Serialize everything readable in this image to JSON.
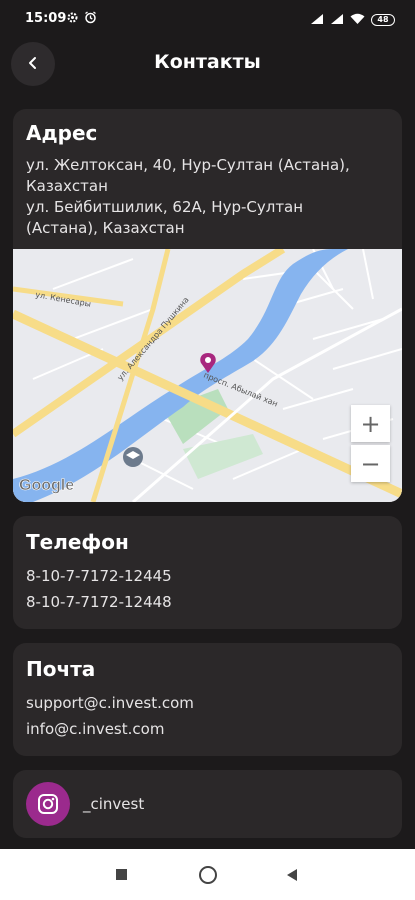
{
  "status_bar": {
    "time": "15:09",
    "battery": "48"
  },
  "header": {
    "title": "Контакты"
  },
  "address": {
    "title": "Адрес",
    "lines": [
      "ул. Желтоксан, 40, Нур-Султан (Астана),",
      "Казахстан",
      "ул. Бейбитшилик, 62А, Нур-Султан",
      "(Астана), Казахстан"
    ]
  },
  "map": {
    "street_labels": [
      "ул. Кенесары",
      "ул. Александра Пушкина",
      "просп. Абылай хан"
    ],
    "provider": "Google",
    "zoom_in": "+",
    "zoom_out": "−",
    "colors": {
      "water": "#86b4ef",
      "road": "#f7dc88",
      "park": "#b9dfbd",
      "marker": "#a8277e"
    }
  },
  "phone": {
    "title": "Телефон",
    "numbers": [
      "8-10-7-7172-12445",
      "8-10-7-7172-12448"
    ]
  },
  "mail": {
    "title": "Почта",
    "addresses": [
      "support@c.invest.com",
      "info@c.invest.com"
    ]
  },
  "instagram": {
    "handle": "_cinvest"
  },
  "colors": {
    "background": "#1c1a1b",
    "card": "#2b2829",
    "accent": "#9b2a8d"
  }
}
